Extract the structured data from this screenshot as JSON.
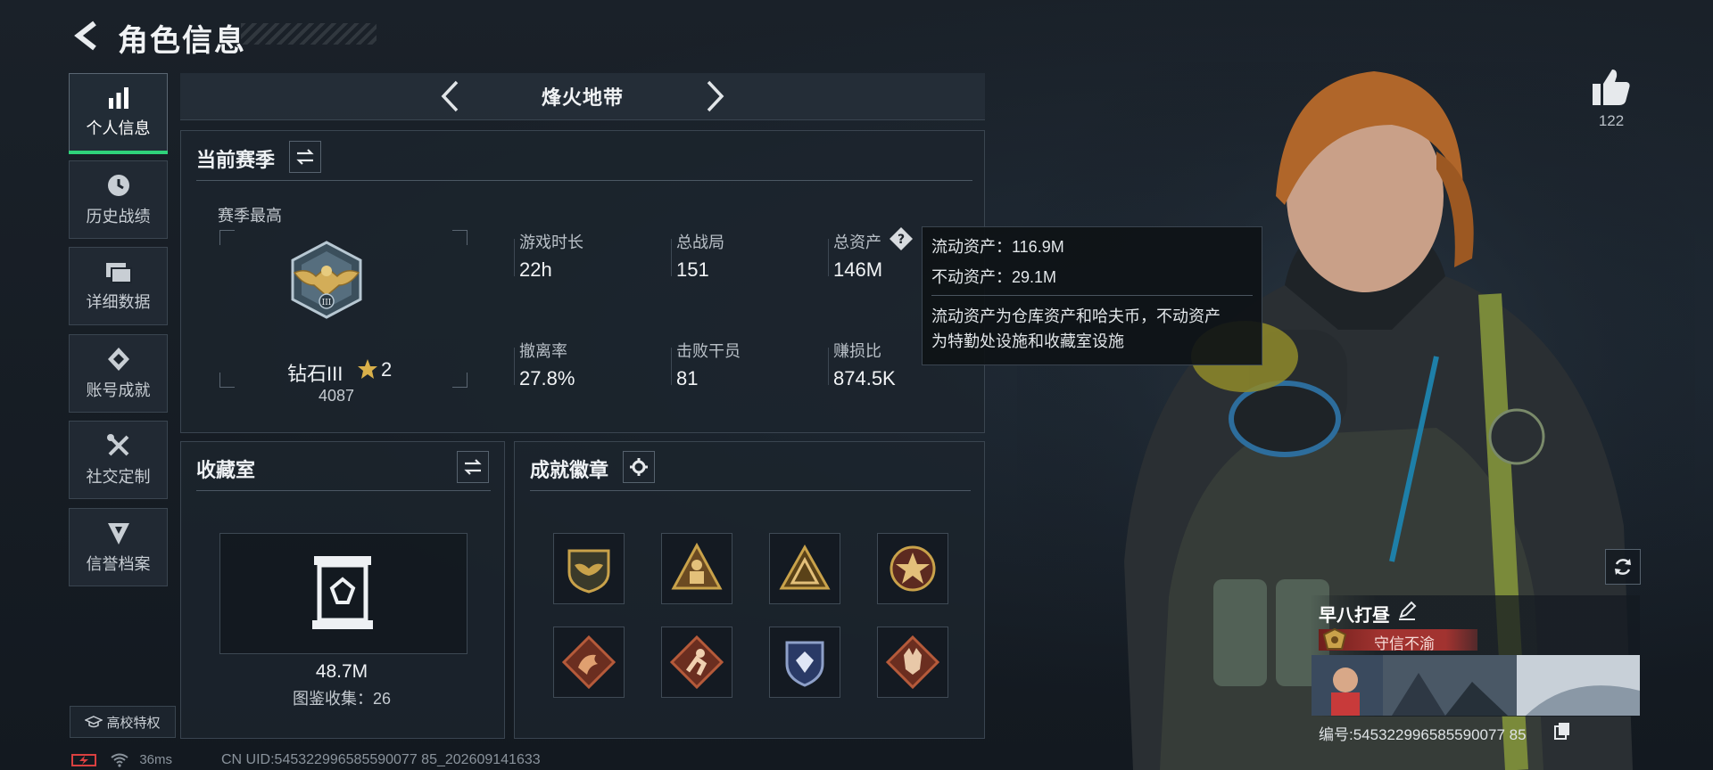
{
  "header": {
    "title": "角色信息"
  },
  "sidebar": {
    "items": [
      {
        "label": "个人信息",
        "icon": "bar-chart-icon",
        "active": true
      },
      {
        "label": "历史战绩",
        "icon": "clock-icon"
      },
      {
        "label": "详细数据",
        "icon": "folder-icon"
      },
      {
        "label": "账号成就",
        "icon": "achievement-icon"
      },
      {
        "label": "社交定制",
        "icon": "tools-icon"
      },
      {
        "label": "信誉档案",
        "icon": "shield-icon"
      }
    ],
    "privilege": "高校特权"
  },
  "mode": {
    "title": "烽火地带"
  },
  "season": {
    "title": "当前赛季",
    "best_label": "赛季最高",
    "rank_name": "钻石III",
    "rank_stars": "2",
    "rank_score": "4087",
    "stats": [
      {
        "label": "游戏时长",
        "value": "22h"
      },
      {
        "label": "总战局",
        "value": "151"
      },
      {
        "label": "总资产",
        "value": "146M"
      },
      {
        "label": "撤离率",
        "value": "27.8%"
      },
      {
        "label": "击败干员",
        "value": "81"
      },
      {
        "label": "赚损比",
        "value": "874.5K"
      }
    ]
  },
  "tooltip": {
    "liquid": "流动资产：116.9M",
    "fixed": "不动资产：29.1M",
    "desc_line1": "流动资产为仓库资产和哈夫币，不动资产",
    "desc_line2": "为特勤处设施和收藏室设施"
  },
  "collection": {
    "title": "收藏室",
    "value": "48.7M",
    "catalog": "图鉴收集：26"
  },
  "badges": {
    "title": "成就徽章",
    "items": [
      {
        "icon": "eagle-badge-icon",
        "color": "#c9a24a"
      },
      {
        "icon": "soldier-badge-icon",
        "color": "#c9a24a"
      },
      {
        "icon": "pyramid-badge-icon",
        "color": "#c9a24a"
      },
      {
        "icon": "star-badge-icon",
        "color": "#c9a24a"
      },
      {
        "icon": "dragon-badge-icon",
        "color": "#b55a3a"
      },
      {
        "icon": "runner-badge-icon",
        "color": "#b55a3a"
      },
      {
        "icon": "diamond-shield-badge-icon",
        "color": "#8ea0c8"
      },
      {
        "icon": "wolf-badge-icon",
        "color": "#b55a3a"
      }
    ]
  },
  "profile": {
    "likes": "122",
    "nickname": "早八打昼",
    "reputation": "守信不渝",
    "id_line": "编号:545322996585590077 85"
  },
  "footer": {
    "ping": "36ms",
    "uid": "CN UID:545322996585590077 85_202609141633"
  },
  "colors": {
    "accent_green": "#2fd27a",
    "reputation_red": "#a23330",
    "gold": "#c9a24a"
  }
}
